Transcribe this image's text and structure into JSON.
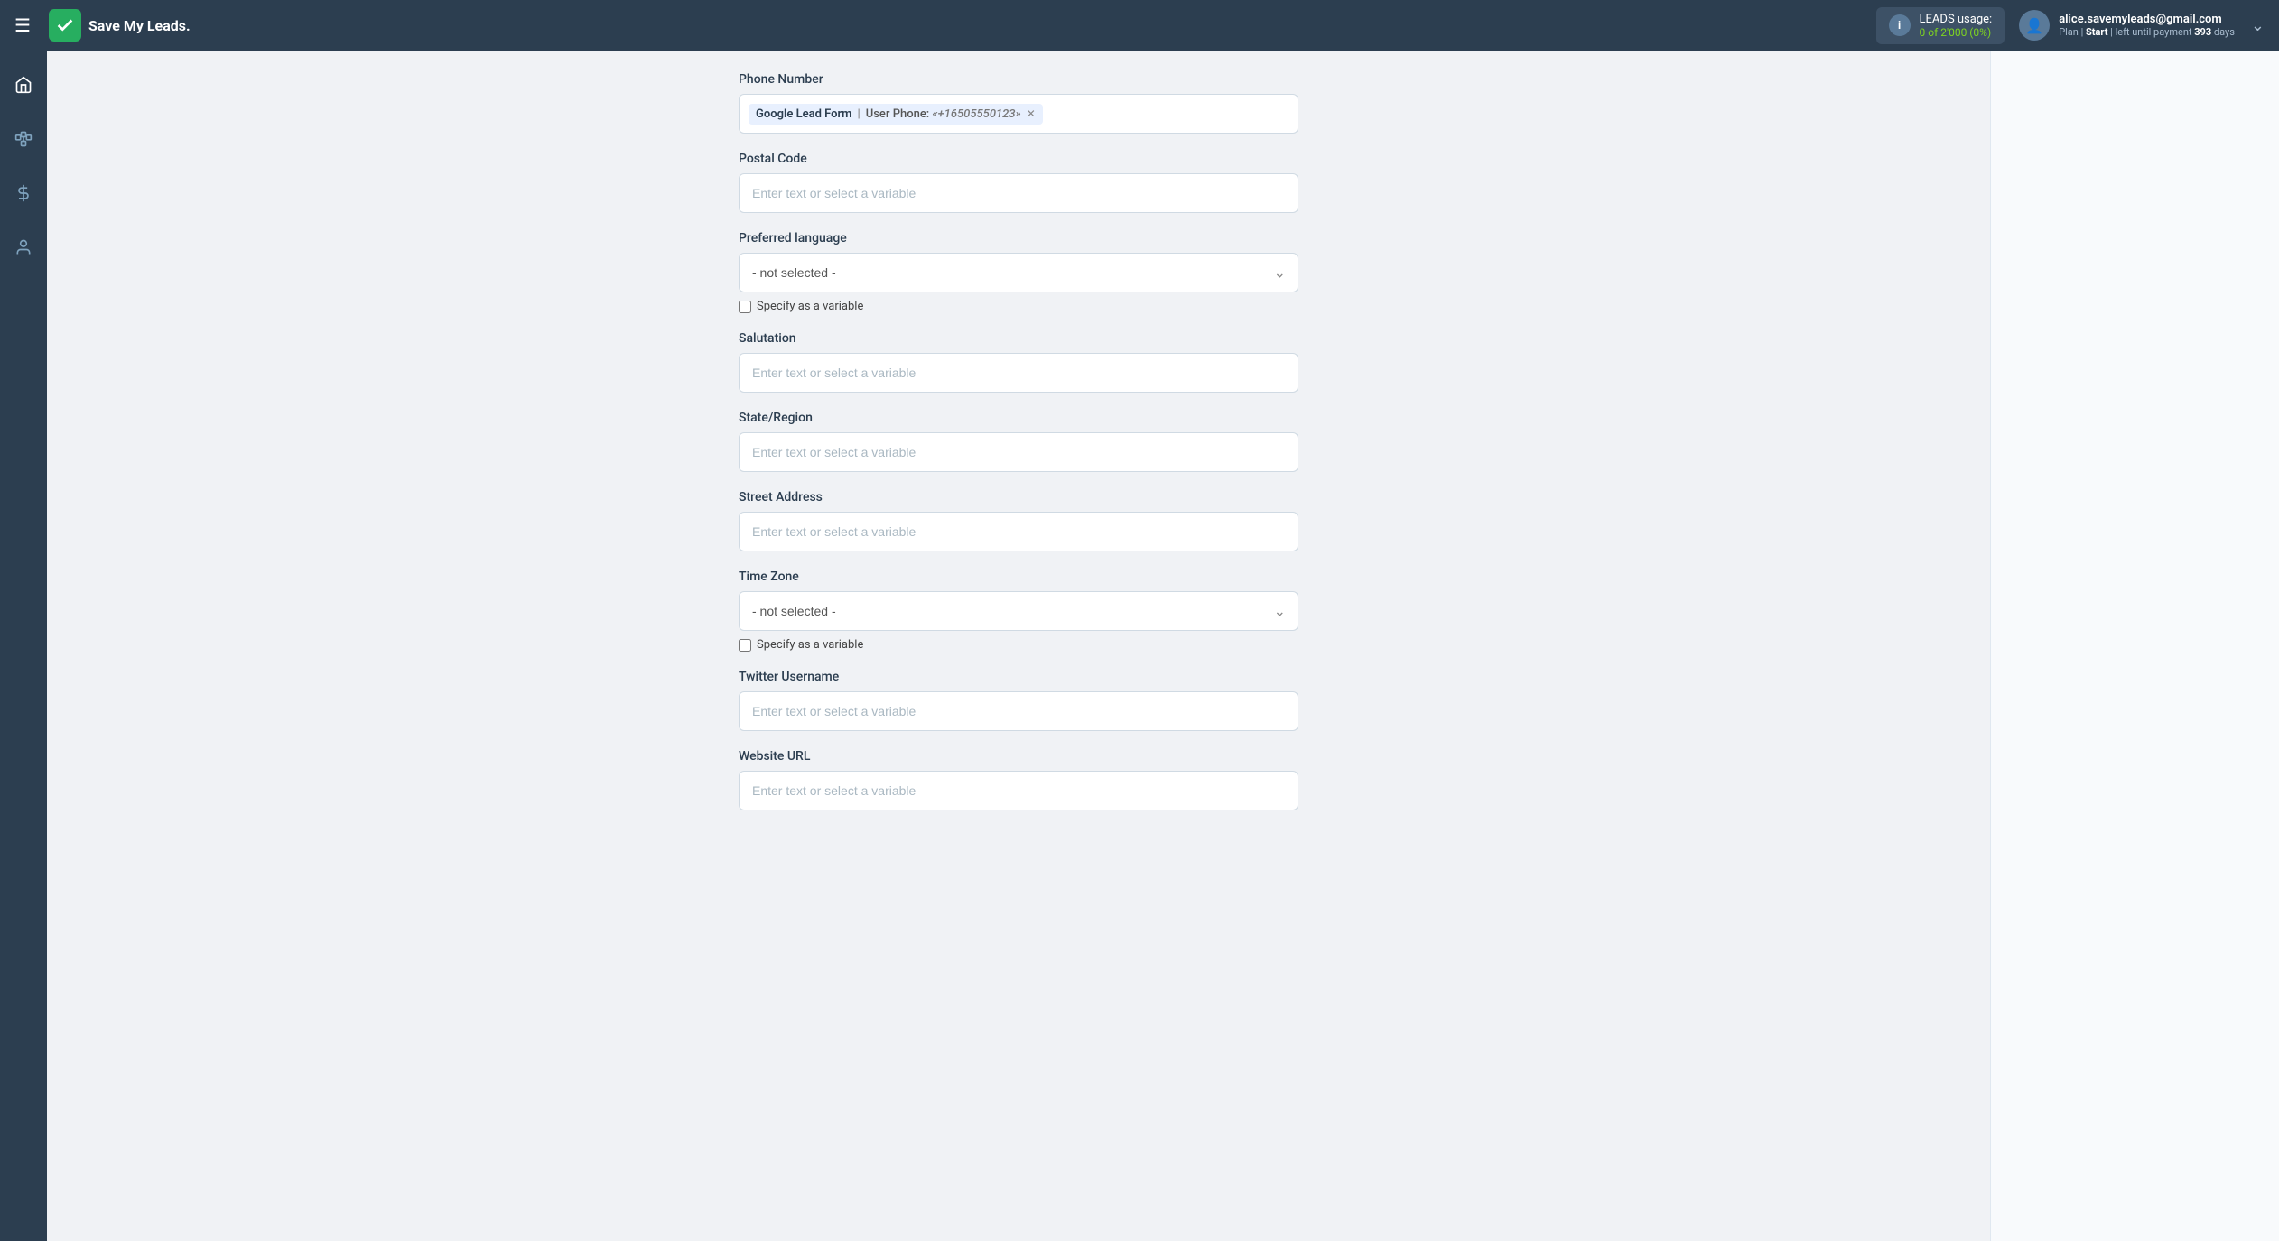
{
  "app": {
    "name": "Save My Leads.",
    "menu_icon": "☰"
  },
  "topnav": {
    "leads_usage_label": "LEADS usage:",
    "leads_count": "0 of 2'000 (0%)",
    "user_email": "alice.savemyleads@gmail.com",
    "user_plan_text": "Plan",
    "user_plan_separator": "|",
    "user_plan_name": "Start",
    "user_plan_suffix": "| left until payment",
    "user_plan_days": "393",
    "user_plan_days_label": "days"
  },
  "sidebar": {
    "items": [
      {
        "icon": "⌂",
        "label": "home"
      },
      {
        "icon": "⬡",
        "label": "integrations"
      },
      {
        "icon": "$",
        "label": "billing"
      },
      {
        "icon": "👤",
        "label": "profile"
      }
    ]
  },
  "form": {
    "fields": [
      {
        "id": "phone_number",
        "label": "Phone Number",
        "type": "tag",
        "tag_source": "Google Lead Form",
        "tag_separator": "|",
        "tag_field": "User Phone:",
        "tag_value": "«+16505550123»"
      },
      {
        "id": "postal_code",
        "label": "Postal Code",
        "type": "text",
        "placeholder": "Enter text or select a variable"
      },
      {
        "id": "preferred_language",
        "label": "Preferred language",
        "type": "select",
        "value": "- not selected -",
        "specify_as_variable": true,
        "specify_label": "Specify as a variable"
      },
      {
        "id": "salutation",
        "label": "Salutation",
        "type": "text",
        "placeholder": "Enter text or select a variable"
      },
      {
        "id": "state_region",
        "label": "State/Region",
        "type": "text",
        "placeholder": "Enter text or select a variable"
      },
      {
        "id": "street_address",
        "label": "Street Address",
        "type": "text",
        "placeholder": "Enter text or select a variable"
      },
      {
        "id": "time_zone",
        "label": "Time Zone",
        "type": "select",
        "value": "- not selected -",
        "specify_as_variable": true,
        "specify_label": "Specify as a variable"
      },
      {
        "id": "twitter_username",
        "label": "Twitter Username",
        "type": "text",
        "placeholder": "Enter text or select a variable"
      },
      {
        "id": "website_url",
        "label": "Website URL",
        "type": "text",
        "placeholder": "Enter text or select a variable"
      }
    ]
  }
}
